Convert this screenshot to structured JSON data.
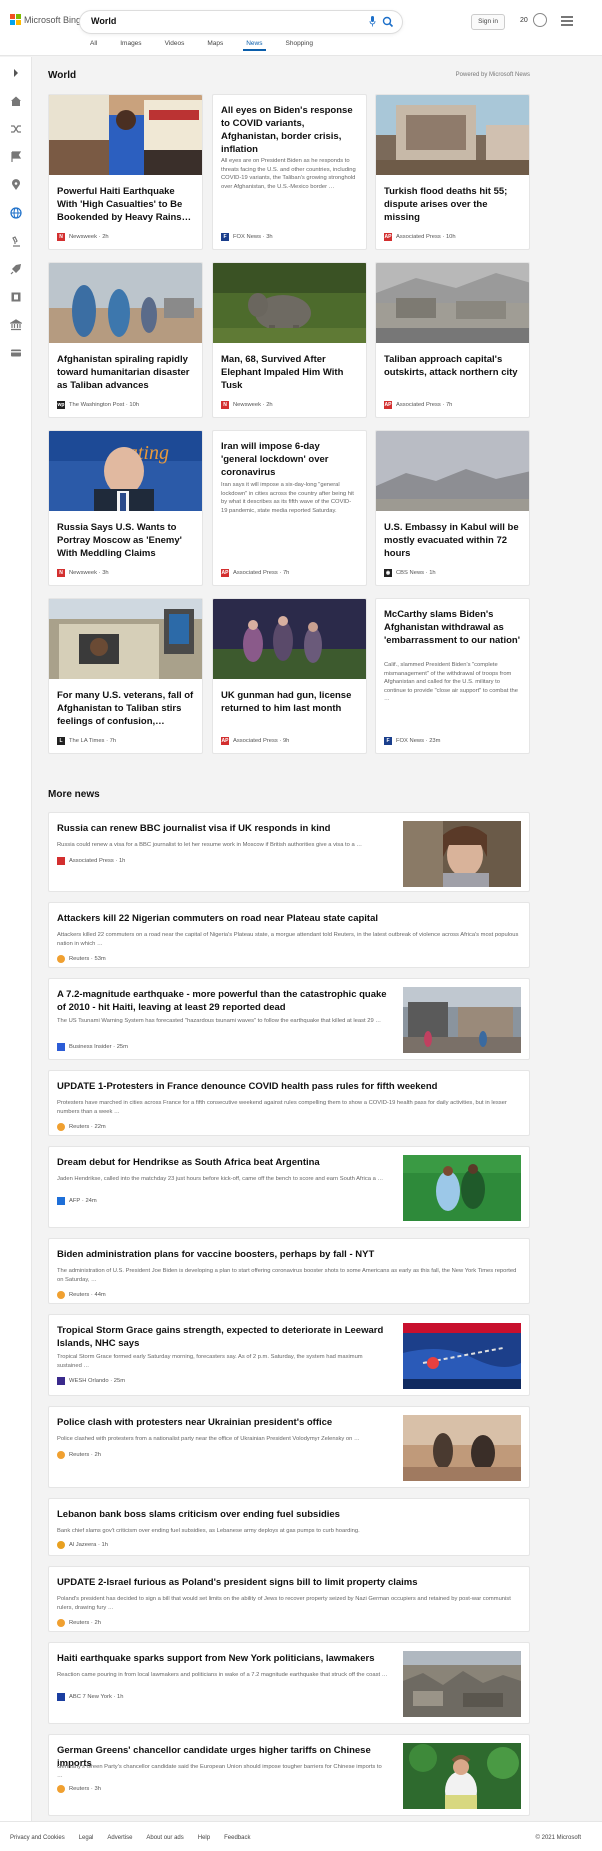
{
  "header": {
    "logo_text": "Microsoft Bing",
    "search_value": "World",
    "signin": "Sign in",
    "points": "20"
  },
  "tabs": [
    "All",
    "Images",
    "Videos",
    "Maps",
    "News",
    "Shopping"
  ],
  "section": {
    "title": "World",
    "powered": "Powered by Microsoft News"
  },
  "cards": [
    {
      "title": "Powerful Haiti Earthquake With 'High Casualties' to Be Bookended by Heavy Rains…",
      "source": "Newsweek",
      "time": "2h",
      "logo": "N",
      "logo_color": "#d32f2f"
    },
    {
      "title": "All eyes on Biden's response to COVID variants, Afghanistan, border crisis, inflation",
      "desc": "All eyes are on President Biden as he responds to threats facing the U.S. and other countries, including COVID-19 variants, the Taliban's growing stronghold over Afghanistan, the U.S.-Mexico border …",
      "source": "FOX News",
      "time": "3h",
      "logo": "F",
      "logo_color": "#1a3e8c"
    },
    {
      "title": "Turkish flood deaths hit 55; dispute arises over the missing",
      "source": "Associated Press",
      "time": "10h",
      "logo": "AP",
      "logo_color": "#d32f2f"
    },
    {
      "title": "Afghanistan spiraling rapidly toward humanitarian disaster as Taliban advances",
      "source": "The Washington Post",
      "time": "10h",
      "logo": "wp",
      "logo_color": "#222"
    },
    {
      "title": "Man, 68, Survived After Elephant Impaled Him With Tusk",
      "source": "Newsweek",
      "time": "2h",
      "logo": "N",
      "logo_color": "#d32f2f"
    },
    {
      "title": "Taliban approach capital's outskirts, attack northern city",
      "source": "Associated Press",
      "time": "7h",
      "logo": "AP",
      "logo_color": "#d32f2f"
    },
    {
      "title": "Russia Says U.S. Wants to Portray Moscow as 'Enemy' With Meddling Claims",
      "source": "Newsweek",
      "time": "3h",
      "logo": "N",
      "logo_color": "#d32f2f"
    },
    {
      "title": "Iran will impose 6-day 'general lockdown' over coronavirus",
      "desc": "Iran says it will impose a six-day-long \"general lockdown\" in cities across the country after being hit by what it describes as its fifth wave of the COVID-19 pandemic, state media reported Saturday.",
      "source": "Associated Press",
      "time": "7h",
      "logo": "AP",
      "logo_color": "#d32f2f"
    },
    {
      "title": "U.S. Embassy in Kabul will be mostly evacuated within 72 hours",
      "source": "CBS News",
      "time": "1h",
      "logo": "◉",
      "logo_color": "#222"
    },
    {
      "title": "For many U.S. veterans, fall of Afghanistan to Taliban stirs feelings of confusion,…",
      "source": "The LA Times",
      "time": "7h",
      "logo": "L",
      "logo_color": "#222"
    },
    {
      "title": "UK gunman had gun, license returned to him last month",
      "source": "Associated Press",
      "time": "9h",
      "logo": "AP",
      "logo_color": "#d32f2f"
    },
    {
      "title": "McCarthy slams Biden's Afghanistan withdrawal as 'embarrassment to our nation'",
      "desc": "Calif., slammed President Biden's \"complete mismanagement\" of the withdrawal of troops from Afghanistan and called for the U.S. military to continue to provide \"close air support\" to combat the …",
      "source": "FOX News",
      "time": "23m",
      "logo": "F",
      "logo_color": "#1a3e8c"
    }
  ],
  "more": {
    "title": "More news"
  },
  "rows": [
    {
      "title": "Russia can renew BBC journalist visa if UK responds in kind",
      "desc": "Russia could renew a visa for a BBC journalist to let her resume work in Moscow if British authorities give a visa to a …",
      "source": "Associated Press",
      "time": "1h",
      "color": "#d32f2f"
    },
    {
      "title": "Attackers kill 22 Nigerian commuters on road near Plateau state capital",
      "desc": "Attackers killed 22 commuters on a road near the capital of Nigeria's Plateau state, a morgue attendant told Reuters, in the latest outbreak of violence across Africa's most populous nation in which …",
      "source": "Reuters",
      "time": "53m",
      "color": "#f0a030"
    },
    {
      "title": "A 7.2-magnitude earthquake - more powerful than the catastrophic quake of 2010 - hit Haiti, leaving at least 29 reported dead",
      "desc": "The US Tsunami Warning System has forecasted \"hazardous tsunami waves\" to follow the earthquake that killed at least 29 …",
      "source": "Business Insider",
      "time": "25m",
      "color": "#2c5cd6"
    },
    {
      "title": "UPDATE 1-Protesters in France denounce COVID health pass rules for fifth weekend",
      "desc": "Protesters have marched in cities across France for a fifth consecutive weekend against rules compelling them to show a COVID-19 health pass for daily activities, but in lesser numbers than a week …",
      "source": "Reuters",
      "time": "22m",
      "color": "#f0a030"
    },
    {
      "title": "Dream debut for Hendrikse as South Africa beat Argentina",
      "desc": "Jaden Hendrikse, called into the matchday 23 just hours before kick-off, came off the bench to score and earn South Africa a …",
      "source": "AFP",
      "time": "24m",
      "color": "#1e6fd8"
    },
    {
      "title": "Biden administration plans for vaccine boosters, perhaps by fall - NYT",
      "desc": "The administration of U.S. President Joe Biden is developing a plan to start offering coronavirus booster shots to some Americans as early as this fall, the New York Times reported on Saturday, …",
      "source": "Reuters",
      "time": "44m",
      "color": "#f0a030"
    },
    {
      "title": "Tropical Storm Grace gains strength, expected to deteriorate in Leeward Islands, NHC says",
      "desc": "Tropical Storm Grace formed early Saturday morning, forecasters say. As of 2 p.m. Saturday, the system had maximum sustained …",
      "source": "WESH Orlando",
      "time": "25m",
      "color": "#3a2a8c"
    },
    {
      "title": "Police clash with protesters near Ukrainian president's office",
      "desc": "Police clashed with protesters from a nationalist party near the office of Ukrainian President Volodymyr Zelensky on …",
      "source": "Reuters",
      "time": "2h",
      "color": "#f0a030"
    },
    {
      "title": "Lebanon bank boss slams criticism over ending fuel subsidies",
      "desc": "Bank chief slams gov't criticism over ending fuel subsidies, as Lebanese army deploys at gas pumps to curb hoarding.",
      "source": "Al Jazeera",
      "time": "1h",
      "color": "#e8a020"
    },
    {
      "title": "UPDATE 2-Israel furious as Poland's president signs bill to limit property claims",
      "desc": "Poland's president has decided to sign a bill that would set limits on the ability of Jews to recover property seized by Nazi German occupiers and retained by post-war communist rulers, drawing fury …",
      "source": "Reuters",
      "time": "2h",
      "color": "#f0a030"
    },
    {
      "title": "Haiti earthquake sparks support from New York politicians, lawmakers",
      "desc": "Reaction came pouring in from local lawmakers and politicians in wake of a 7.2 magnitude earthquake that struck off the coast …",
      "source": "ABC 7 New York",
      "time": "1h",
      "color": "#1a3ea0"
    },
    {
      "title": "German Greens' chancellor candidate urges higher tariffs on Chinese imports",
      "desc": "Germany's Green Party's chancellor candidate said the European Union should impose tougher barriers for Chinese imports to …",
      "source": "Reuters",
      "time": "3h",
      "color": "#f0a030"
    }
  ],
  "footer": {
    "links": [
      "Privacy and Cookies",
      "Legal",
      "Advertise",
      "About our ads",
      "Help",
      "Feedback"
    ],
    "copyright": "© 2021 Microsoft"
  }
}
